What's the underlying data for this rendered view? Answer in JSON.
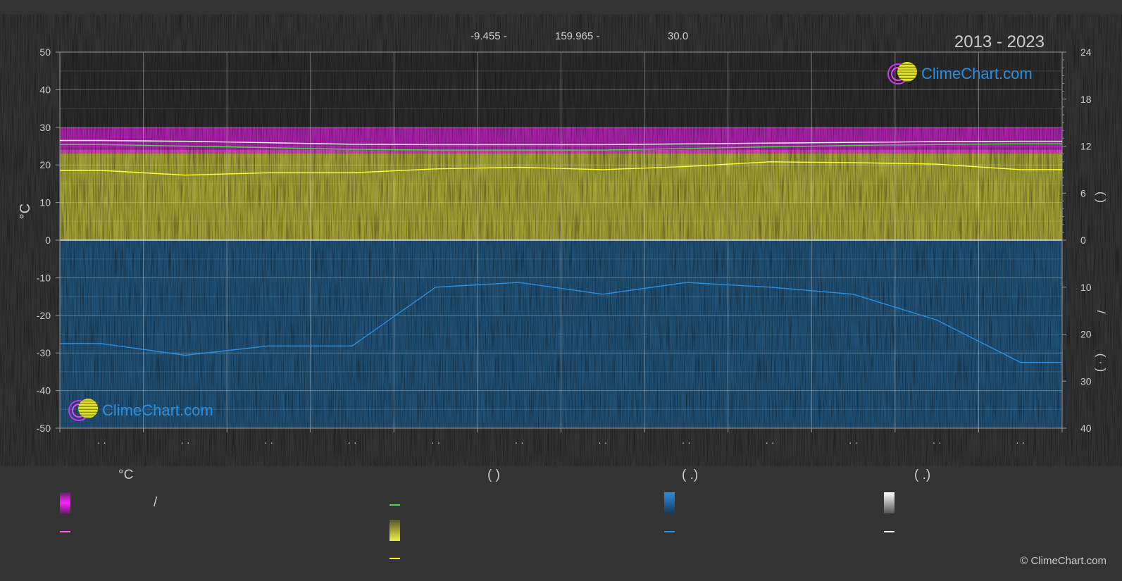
{
  "header": {
    "coordinates": [
      "-9.455 -",
      "159.965 -",
      "30.0"
    ],
    "years": "2013 - 2023"
  },
  "logo": {
    "text": "ClimeChart.com"
  },
  "copyright": "© ClimeChart.com",
  "colors": {
    "background": "#333333",
    "temperature_band": "#e020e0",
    "sunshine_band": "#c8c83a",
    "precipitation_band": "#1a6fb0",
    "daylight_line": "#44dd44",
    "sunshine_line": "#ffff33",
    "precipitation_line": "#2a8fe0",
    "temperature_line": "#ffffff"
  },
  "legend": {
    "headers": [
      "°C",
      "(          )",
      "(   .)",
      "(   .)"
    ],
    "texts": [
      "/"
    ]
  },
  "chart_data": {
    "type": "area",
    "ylabel": "°C",
    "y_left": {
      "range": [
        -50,
        50
      ],
      "ticks": [
        "50",
        "40",
        "30",
        "20",
        "10",
        "0",
        "-10",
        "-20",
        "-30",
        "-40",
        "-50"
      ]
    },
    "y_right_top": {
      "range": [
        0,
        24
      ],
      "ticks": [
        "24",
        "18",
        "12",
        "6",
        "0"
      ]
    },
    "y_right_bottom": {
      "range": [
        0,
        40
      ],
      "ticks": [
        "10",
        "20",
        "30",
        "40"
      ]
    },
    "right_axis_labels": [
      "(     )",
      "/",
      "(  ·  )"
    ],
    "x_tick_labels": [
      "· ·",
      "· ·",
      "· ·",
      "· ·",
      "· ·",
      "· ·",
      "· ·",
      "· ·",
      "· ·",
      "· ·",
      "· ·",
      "· ·"
    ],
    "grid": true,
    "series": [
      {
        "axis": "temp_c",
        "values": [
          26.5,
          26.3,
          25.9,
          25.5,
          25.4,
          25.4,
          25.4,
          25.6,
          25.8,
          26.0,
          26.2,
          26.3
        ]
      },
      {
        "axis": "hours",
        "values": [
          12.2,
          12.0,
          11.8,
          11.6,
          11.5,
          11.5,
          11.5,
          11.7,
          11.9,
          12.1,
          12.2,
          12.3
        ]
      },
      {
        "axis": "hours",
        "values": [
          8.9,
          8.3,
          8.6,
          8.6,
          9.1,
          9.3,
          9.0,
          9.4,
          10.0,
          9.9,
          9.7,
          9.0
        ]
      },
      {
        "axis": "precip_mm",
        "values": [
          22,
          24.5,
          22.5,
          22.5,
          10,
          9,
          11.5,
          9,
          10,
          11.5,
          17,
          26
        ]
      }
    ]
  }
}
